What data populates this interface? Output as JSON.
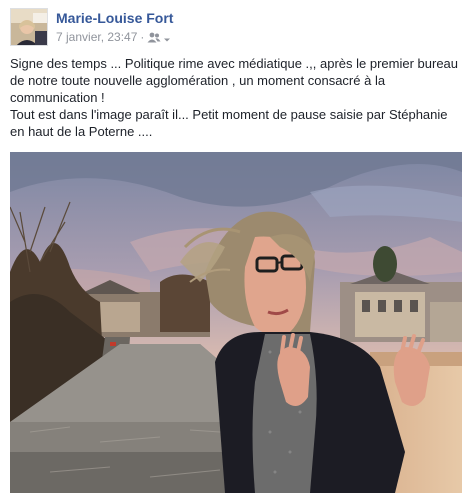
{
  "post": {
    "author": "Marie-Louise Fort",
    "timestamp": "7 janvier, 23:47",
    "separator": "·",
    "privacy_icon": "friends-icon",
    "text_lines": [
      "Signe des temps ... Politique rime avec médiatique .,, après le premier bureau",
      "de notre toute nouvelle agglomération , un moment consacré à la",
      "communication !",
      "Tout est dans l'image paraît il... Petit moment de pause saisie par Stéphanie",
      "en haut de la Poterne ...."
    ]
  },
  "colors": {
    "author_link": "#365899",
    "meta_text": "#90949c",
    "body_text": "#1d2129"
  }
}
